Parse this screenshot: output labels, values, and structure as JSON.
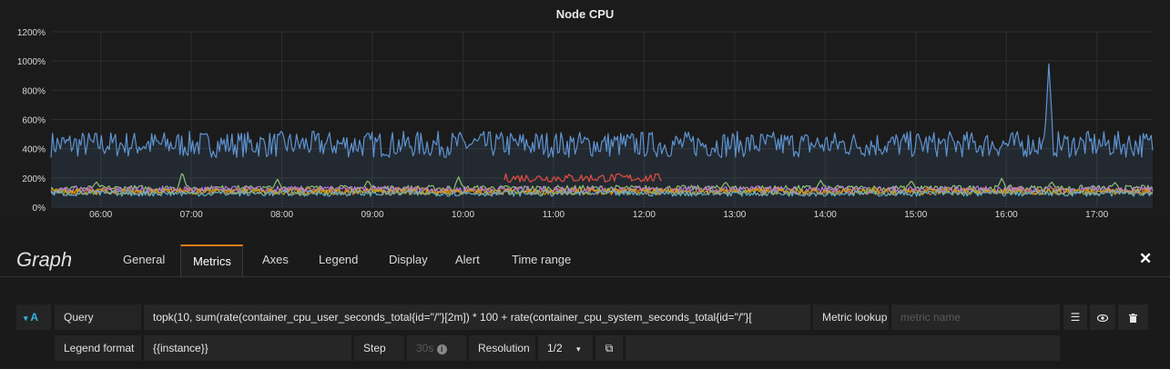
{
  "chart_data": {
    "type": "line",
    "title": "Node CPU",
    "y_ticks": [
      "0%",
      "200%",
      "400%",
      "600%",
      "800%",
      "1000%",
      "1200%"
    ],
    "ylim": [
      0,
      1200
    ],
    "x_ticks": [
      "06:00",
      "07:00",
      "08:00",
      "09:00",
      "10:00",
      "11:00",
      "12:00",
      "13:00",
      "14:00",
      "15:00",
      "16:00",
      "17:00"
    ],
    "x_range": [
      "05:27",
      "17:37"
    ],
    "grid": true,
    "series": [
      {
        "color": "#5e93d1",
        "baseline": 430,
        "noise": 90,
        "spikes": [
          [
            16.47,
            985
          ]
        ]
      },
      {
        "color": "#8fc276",
        "baseline": 130,
        "noise": 20,
        "spikes": [
          [
            5.95,
            175
          ],
          [
            6.9,
            245
          ],
          [
            7.95,
            195
          ],
          [
            8.95,
            185
          ],
          [
            9.95,
            210
          ],
          [
            12.9,
            175
          ],
          [
            13.95,
            185
          ],
          [
            14.95,
            185
          ],
          [
            15.95,
            200
          ],
          [
            16.5,
            175
          ],
          [
            17.2,
            170
          ]
        ]
      },
      {
        "color": "#e24d42",
        "baseline": 200,
        "noise": 30,
        "range": [
          10.45,
          12.2
        ]
      },
      {
        "color": "#e0752d",
        "baseline": 110,
        "noise": 25
      },
      {
        "color": "#b877d9",
        "baseline": 120,
        "noise": 25
      },
      {
        "color": "#cca300",
        "baseline": 105,
        "noise": 20
      },
      {
        "color": "#64b0c8",
        "baseline": 95,
        "noise": 20
      }
    ]
  },
  "editor": {
    "title": "Graph",
    "tabs": [
      "General",
      "Metrics",
      "Axes",
      "Legend",
      "Display",
      "Alert",
      "Time range"
    ],
    "active_tab": "Metrics",
    "close_icon": "close-icon"
  },
  "query": {
    "ref_id": "A",
    "query_label": "Query",
    "query_value": "topk(10, sum(rate(container_cpu_user_seconds_total{id=\"/\"}[2m]) * 100 + rate(container_cpu_system_seconds_total{id=\"/\"}[",
    "metric_lookup_label": "Metric lookup",
    "metric_placeholder": "metric name",
    "legend_format_label": "Legend format",
    "legend_format_value": "{{instance}}",
    "step_label": "Step",
    "step_placeholder": "30s",
    "resolution_label": "Resolution",
    "resolution_value": "1/2"
  },
  "colors": {
    "accent": "#eb7b18",
    "query_ref": "#33b5e5"
  }
}
